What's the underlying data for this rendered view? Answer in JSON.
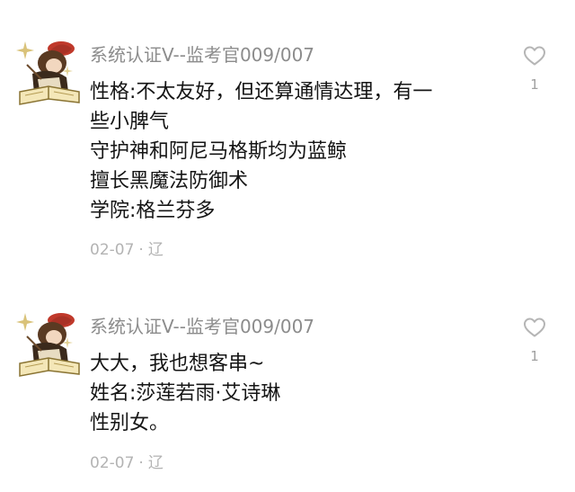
{
  "comments": [
    {
      "username": "系统认证V--监考官009/007",
      "lines": [
        "性格:不太友好，但还算通情达理，有一",
        "些小脾气",
        "守护神和阿尼马格斯均为蓝鲸",
        "擅长黑魔法防御术",
        "学院:格兰芬多"
      ],
      "date": "02-07",
      "location": "辽",
      "likes": "1",
      "like_icon": "heart-outline-icon"
    },
    {
      "username": "系统认证V--监考官009/007",
      "lines": [
        "大大，我也想客串~",
        "姓名:莎莲若雨·艾诗琳",
        "性别女。"
      ],
      "date": "02-07",
      "location": "辽",
      "likes": "1",
      "like_icon": "heart-outline-icon"
    }
  ],
  "meta_separator": "·",
  "colors": {
    "username": "#8c8c8c",
    "content": "#151515",
    "meta": "#b3b3b3",
    "heart_stroke": "#b5b5b5"
  }
}
